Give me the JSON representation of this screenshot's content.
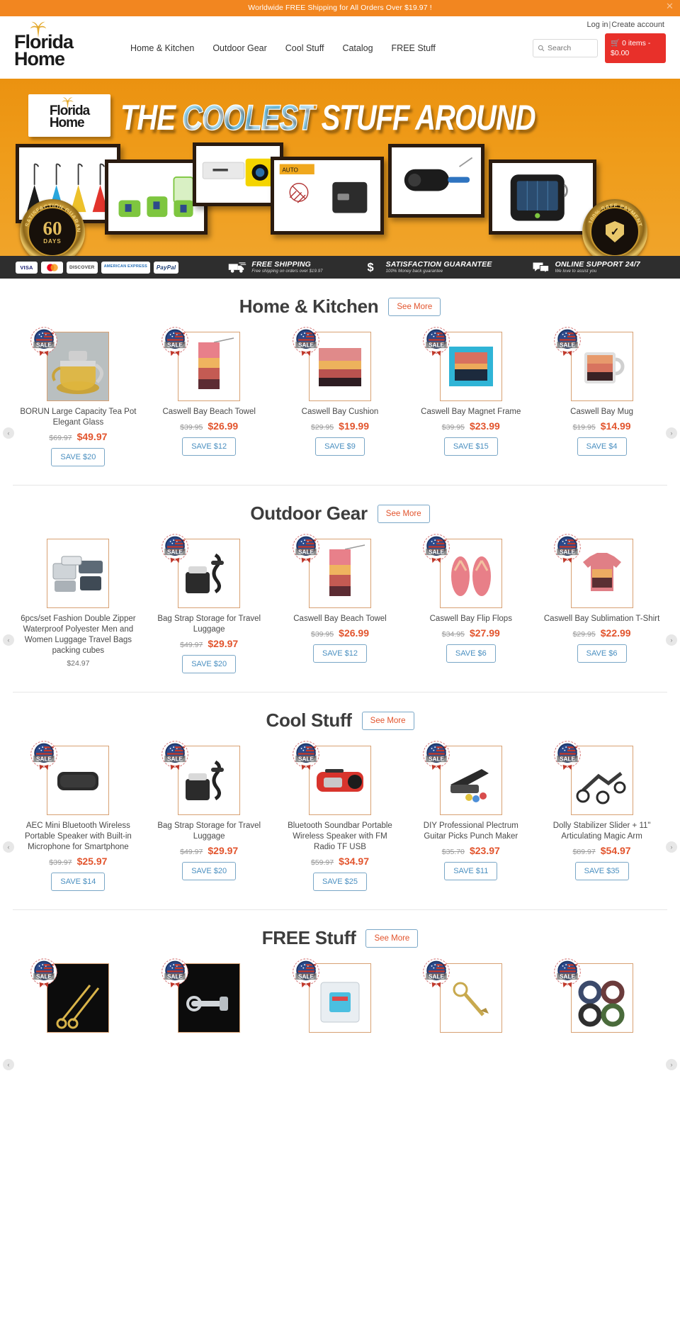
{
  "announcement": {
    "text": "Worldwide FREE Shipping for All Orders Over $19.97 !",
    "close_label": "✕"
  },
  "header": {
    "login_label": "Log in",
    "separator": "|",
    "create_account_label": "Create account",
    "logo_line1": "Florida",
    "logo_line2": "Home",
    "nav": [
      {
        "label": "Home & Kitchen"
      },
      {
        "label": "Outdoor Gear"
      },
      {
        "label": "Cool Stuff"
      },
      {
        "label": "Catalog"
      },
      {
        "label": "FREE Stuff"
      }
    ],
    "search_placeholder": "Search",
    "cart_label": "0 items - $0.00"
  },
  "hero": {
    "logo_line1": "Florida",
    "logo_line2": "Home",
    "title_pre": "THE ",
    "title_highlight": "COOLEST",
    "title_post": " STUFF AROUND",
    "seal_left_ring": "SATISFACTION GUARANTEE",
    "seal_left_big": "60",
    "seal_left_small": "DAYS",
    "seal_right_ring": "100% SAFE PAYMENT"
  },
  "trust": {
    "payments": [
      {
        "name": "VISA"
      },
      {
        "name": "Mastercard"
      },
      {
        "name": "DISCOVER"
      },
      {
        "name": "AMERICAN EXPRESS"
      },
      {
        "name": "PayPal"
      }
    ],
    "features": [
      {
        "title": "FREE SHIPPING",
        "sub": "Free shipping on orders over $19.97",
        "icon": "truck-icon"
      },
      {
        "title": "SATISFACTION GUARANTEE",
        "sub": "100% Money back guarantee",
        "icon": "dollar-icon"
      },
      {
        "title": "ONLINE SUPPORT 24/7",
        "sub": "We love to assist you",
        "icon": "chat-icon"
      }
    ]
  },
  "sections": [
    {
      "title": "Home & Kitchen",
      "see_more": "See More",
      "products": [
        {
          "title": "BORUN Large Capacity Tea Pot Elegant Glass",
          "old_price": "$69.97",
          "new_price": "$49.97",
          "save": "SAVE $20",
          "badge": "SALE",
          "image": "teapot"
        },
        {
          "title": "Caswell Bay Beach Towel",
          "old_price": "$39.95",
          "new_price": "$26.99",
          "save": "SAVE $12",
          "badge": "SALE",
          "image": "towel"
        },
        {
          "title": "Caswell Bay Cushion",
          "old_price": "$29.95",
          "new_price": "$19.99",
          "save": "SAVE $9",
          "badge": "SALE",
          "image": "cushion"
        },
        {
          "title": "Caswell Bay Magnet Frame",
          "old_price": "$39.95",
          "new_price": "$23.99",
          "save": "SAVE $15",
          "badge": "SALE",
          "image": "frame"
        },
        {
          "title": "Caswell Bay Mug",
          "old_price": "$19.95",
          "new_price": "$14.99",
          "save": "SAVE $4",
          "badge": "SALE",
          "image": "mug"
        }
      ]
    },
    {
      "title": "Outdoor Gear",
      "see_more": "See More",
      "products": [
        {
          "title": "6pcs/set Fashion Double Zipper Waterproof Polyester Men and Women Luggage Travel Bags packing cubes",
          "old_price": "",
          "new_price": "",
          "single_price": "$24.97",
          "save": "",
          "badge": "",
          "image": "cubes"
        },
        {
          "title": "Bag Strap Storage for Travel Luggage",
          "old_price": "$49.97",
          "new_price": "$29.97",
          "save": "SAVE $20",
          "badge": "SALE",
          "image": "bagstrap"
        },
        {
          "title": "Caswell Bay Beach Towel",
          "old_price": "$39.95",
          "new_price": "$26.99",
          "save": "SAVE $12",
          "badge": "SALE",
          "image": "towel"
        },
        {
          "title": "Caswell Bay Flip Flops",
          "old_price": "$34.95",
          "new_price": "$27.99",
          "save": "SAVE $6",
          "badge": "SALE",
          "image": "flipflops"
        },
        {
          "title": "Caswell Bay Sublimation T-Shirt",
          "old_price": "$29.95",
          "new_price": "$22.99",
          "save": "SAVE $6",
          "badge": "SALE",
          "image": "tshirt"
        }
      ]
    },
    {
      "title": "Cool Stuff",
      "see_more": "See More",
      "products": [
        {
          "title": "AEC Mini Bluetooth Wireless Portable Speaker with Built-in Microphone for Smartphone",
          "old_price": "$39.97",
          "new_price": "$25.97",
          "save": "SAVE $14",
          "badge": "SALE",
          "image": "speaker"
        },
        {
          "title": "Bag Strap Storage for Travel Luggage",
          "old_price": "$49.97",
          "new_price": "$29.97",
          "save": "SAVE $20",
          "badge": "SALE",
          "image": "bagstrap"
        },
        {
          "title": "Bluetooth Soundbar Portable Wireless Speaker with FM Radio TF USB",
          "old_price": "$59.97",
          "new_price": "$34.97",
          "save": "SAVE $25",
          "badge": "SALE",
          "image": "soundbar"
        },
        {
          "title": "DIY Professional Plectrum Guitar Picks Punch Maker",
          "old_price": "$35.70",
          "new_price": "$23.97",
          "save": "SAVE $11",
          "badge": "SALE",
          "image": "punch"
        },
        {
          "title": "Dolly Stabilizer Slider + 11\" Articulating Magic Arm",
          "old_price": "$89.97",
          "new_price": "$54.97",
          "save": "SAVE $35",
          "badge": "SALE",
          "image": "dolly"
        }
      ]
    },
    {
      "title": "FREE Stuff",
      "see_more": "See More",
      "products": [
        {
          "title": "",
          "old_price": "",
          "new_price": "",
          "save": "",
          "badge": "SALE",
          "image": "scissors"
        },
        {
          "title": "",
          "old_price": "",
          "new_price": "",
          "save": "",
          "badge": "SALE",
          "image": "opener"
        },
        {
          "title": "",
          "old_price": "",
          "new_price": "",
          "save": "",
          "badge": "SALE",
          "image": "peeler"
        },
        {
          "title": "",
          "old_price": "",
          "new_price": "",
          "save": "",
          "badge": "SALE",
          "image": "keychain"
        },
        {
          "title": "",
          "old_price": "",
          "new_price": "",
          "save": "",
          "badge": "SALE",
          "image": "bracelets"
        }
      ]
    }
  ],
  "carousel": {
    "prev": "‹",
    "next": "›"
  },
  "colors": {
    "accent_orange": "#f28620",
    "price_red": "#e2542d",
    "cart_red": "#e8302a",
    "button_blue": "#4a8fc0",
    "trust_dark": "#2e2e2e"
  }
}
